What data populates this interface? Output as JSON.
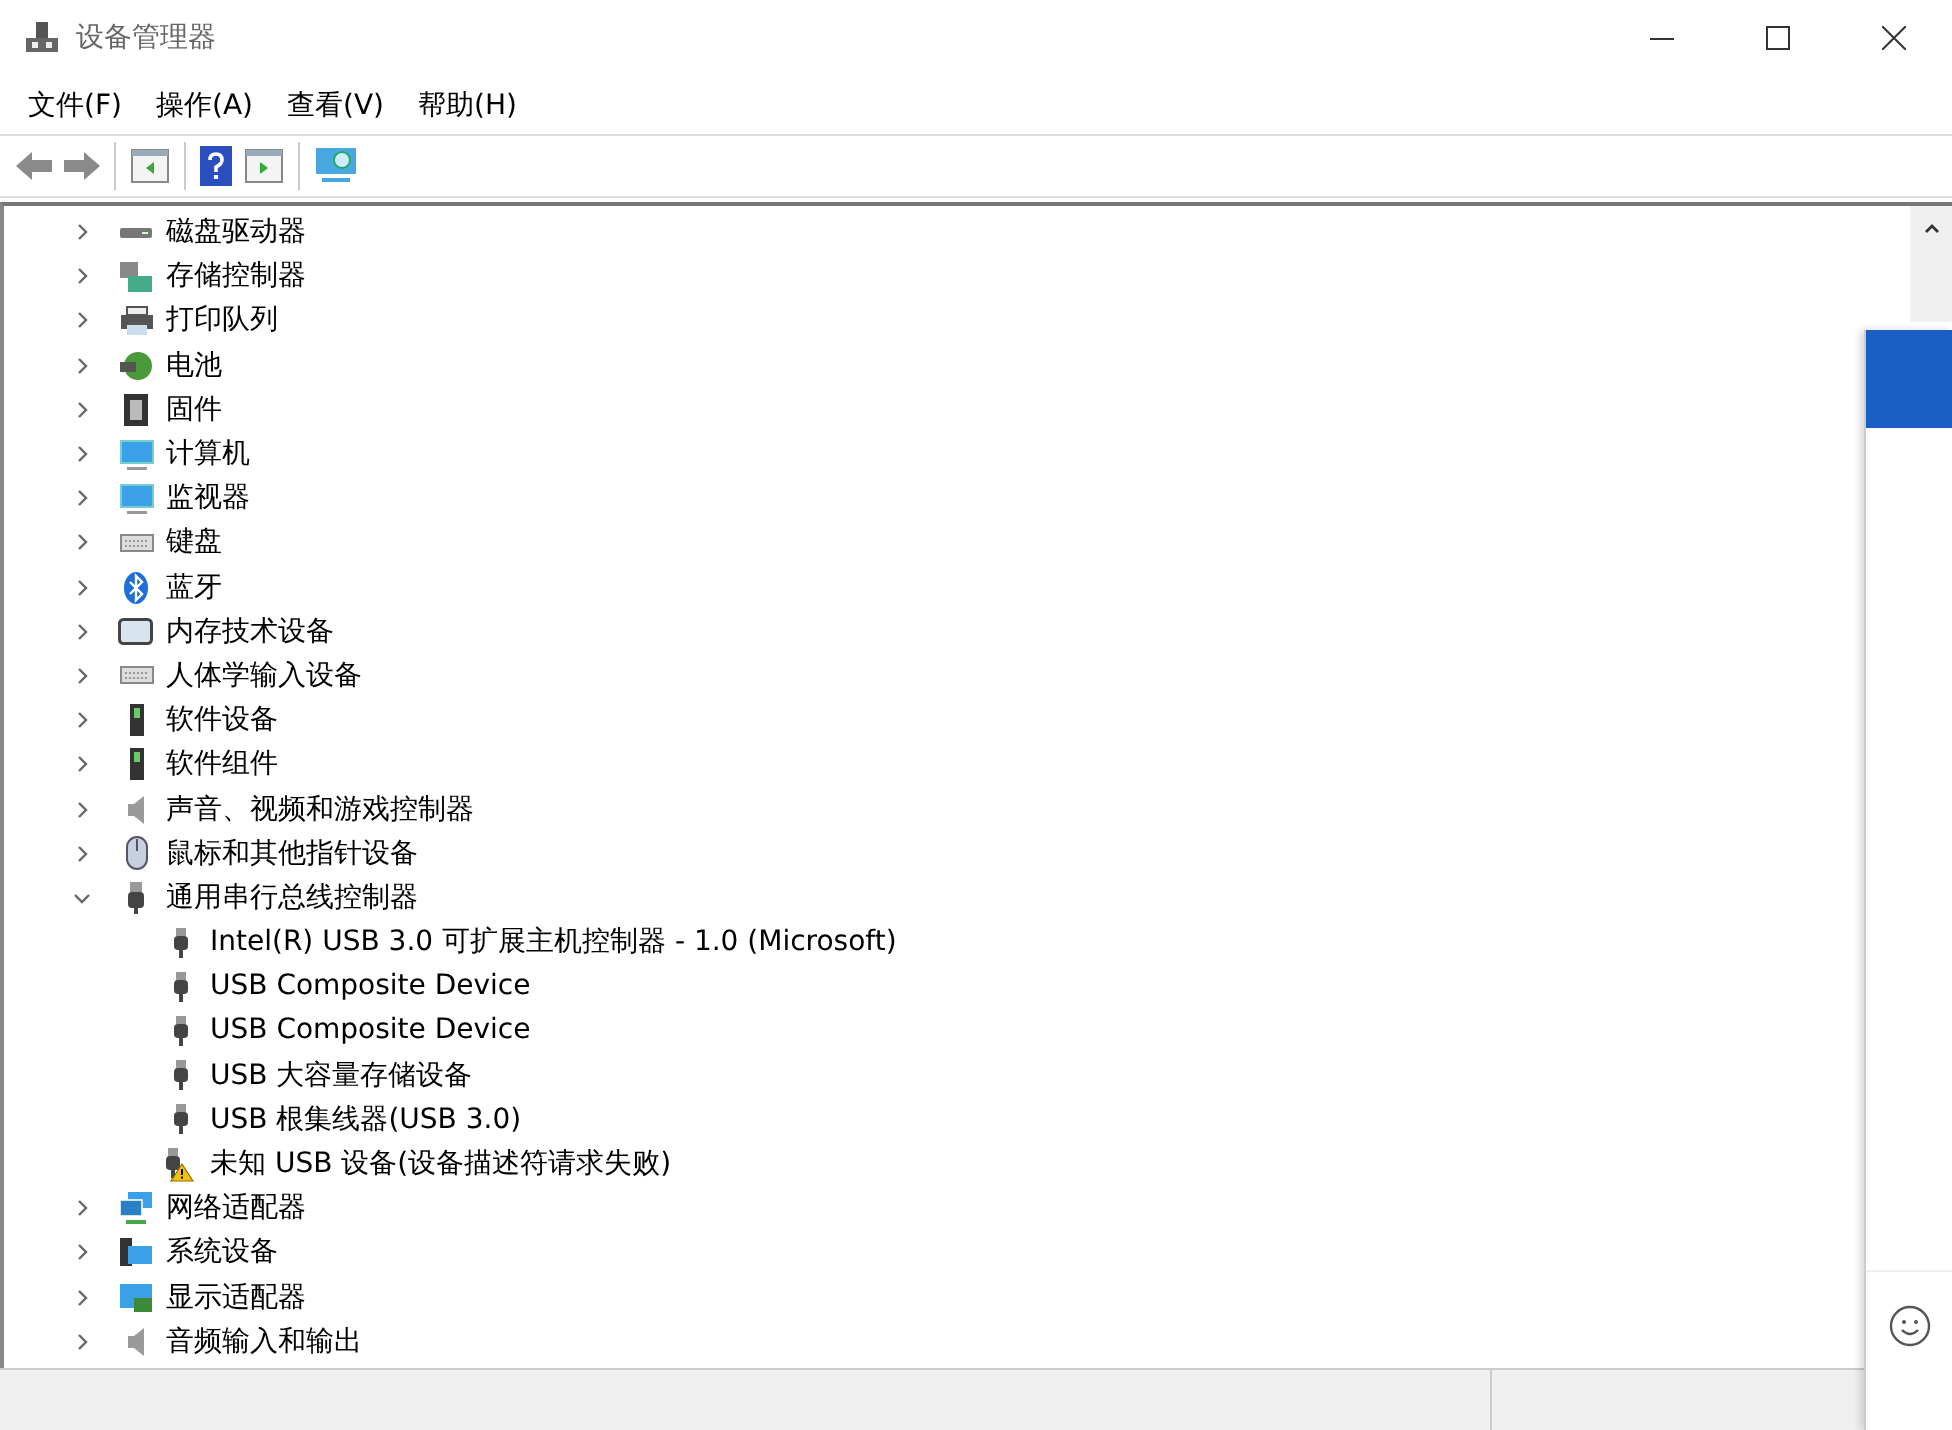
{
  "window": {
    "title": "设备管理器"
  },
  "menu": [
    {
      "label": "文件(F)"
    },
    {
      "label": "操作(A)"
    },
    {
      "label": "查看(V)"
    },
    {
      "label": "帮助(H)"
    }
  ],
  "tree": [
    {
      "label": "磁盘驱动器",
      "kind": "disk",
      "expanded": false
    },
    {
      "label": "存储控制器",
      "kind": "storage",
      "expanded": false
    },
    {
      "label": "打印队列",
      "kind": "printer",
      "expanded": false
    },
    {
      "label": "电池",
      "kind": "battery",
      "expanded": false
    },
    {
      "label": "固件",
      "kind": "chip",
      "expanded": false
    },
    {
      "label": "计算机",
      "kind": "monitor",
      "expanded": false
    },
    {
      "label": "监视器",
      "kind": "monitor",
      "expanded": false
    },
    {
      "label": "键盘",
      "kind": "keyboard",
      "expanded": false
    },
    {
      "label": "蓝牙",
      "kind": "bluetooth",
      "expanded": false
    },
    {
      "label": "内存技术设备",
      "kind": "memory",
      "expanded": false
    },
    {
      "label": "人体学输入设备",
      "kind": "keyboard",
      "expanded": false
    },
    {
      "label": "软件设备",
      "kind": "tower",
      "expanded": false
    },
    {
      "label": "软件组件",
      "kind": "tower",
      "expanded": false
    },
    {
      "label": "声音、视频和游戏控制器",
      "kind": "speaker",
      "expanded": false
    },
    {
      "label": "鼠标和其他指针设备",
      "kind": "mouse",
      "expanded": false
    },
    {
      "label": "通用串行总线控制器",
      "kind": "usb",
      "expanded": true,
      "children": [
        {
          "label": "Intel(R) USB 3.0 可扩展主机控制器 - 1.0 (Microsoft)",
          "kind": "usb",
          "warning": false
        },
        {
          "label": "USB Composite Device",
          "kind": "usb",
          "warning": false
        },
        {
          "label": "USB Composite Device",
          "kind": "usb",
          "warning": false
        },
        {
          "label": "USB 大容量存储设备",
          "kind": "usb",
          "warning": false
        },
        {
          "label": "USB 根集线器(USB 3.0)",
          "kind": "usb",
          "warning": false
        },
        {
          "label": "未知 USB 设备(设备描述符请求失败)",
          "kind": "usb",
          "warning": true
        }
      ]
    },
    {
      "label": "网络适配器",
      "kind": "network",
      "expanded": false
    },
    {
      "label": "系统设备",
      "kind": "system",
      "expanded": false
    },
    {
      "label": "显示适配器",
      "kind": "display",
      "expanded": false
    },
    {
      "label": "音频输入和输出",
      "kind": "speaker",
      "expanded": false
    }
  ]
}
